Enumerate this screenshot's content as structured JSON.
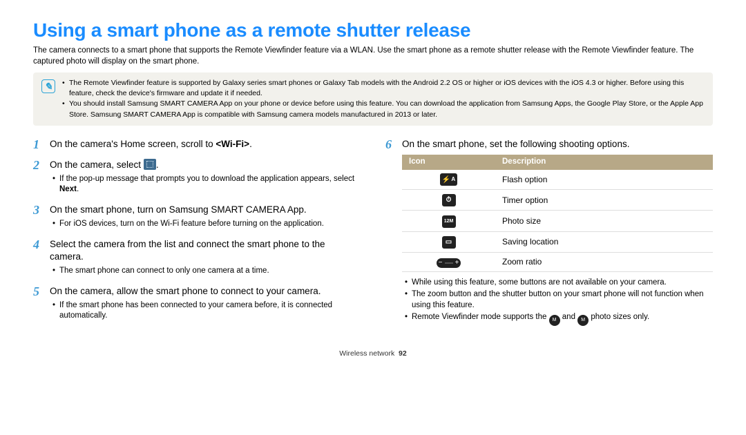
{
  "title": "Using a smart phone as a remote shutter release",
  "intro": "The camera connects to a smart phone that supports the Remote Viewfinder feature via a WLAN. Use the smart phone as a remote shutter release with the Remote Viewfinder feature. The captured photo will display on the smart phone.",
  "notes": [
    "The Remote Viewfinder feature is supported by Galaxy series smart phones or Galaxy Tab models with the Android 2.2 OS or higher or iOS devices with the iOS 4.3 or higher. Before using this feature, check the device's firmware and update it if needed.",
    "You should install Samsung SMART CAMERA App on your phone or device before using this feature. You can download the application from Samsung Apps, the Google Play Store, or the Apple App Store. Samsung SMART CAMERA App is compatible with Samsung camera models manufactured in 2013 or later."
  ],
  "steps": {
    "s1": {
      "prefix": "On the camera's Home screen, scroll to ",
      "bold": "<Wi-Fi>",
      "suffix": "."
    },
    "s2": {
      "text": "On the camera, select",
      "sub_prefix": "If the pop-up message that prompts you to download the application appears, select ",
      "sub_bold": "Next",
      "sub_suffix": "."
    },
    "s3": {
      "text": "On the smart phone, turn on Samsung SMART CAMERA App.",
      "sub": "For iOS devices, turn on the Wi-Fi feature before turning on the application."
    },
    "s4": {
      "text": "Select the camera from the list and connect the smart phone to the camera.",
      "sub": "The smart phone can connect to only one camera at a time."
    },
    "s5": {
      "text": "On the camera, allow the smart phone to connect to your camera.",
      "sub": "If the smart phone has been connected to your camera before, it is connected automatically."
    },
    "s6": {
      "text": "On the smart phone, set the following shooting options."
    }
  },
  "table": {
    "h1": "Icon",
    "h2": "Description",
    "rows": [
      {
        "desc": "Flash option"
      },
      {
        "desc": "Timer option"
      },
      {
        "desc": "Photo size"
      },
      {
        "desc": "Saving location"
      },
      {
        "desc": "Zoom ratio"
      }
    ]
  },
  "post_notes": {
    "n1": "While using this feature, some buttons are not available on your camera.",
    "n2": "The zoom button and the shutter button on your smart phone will not function when using this feature.",
    "n3a": "Remote Viewfinder mode supports the ",
    "n3b": " and ",
    "n3c": " photo sizes only."
  },
  "footer": {
    "section": "Wireless network",
    "page": "92"
  }
}
